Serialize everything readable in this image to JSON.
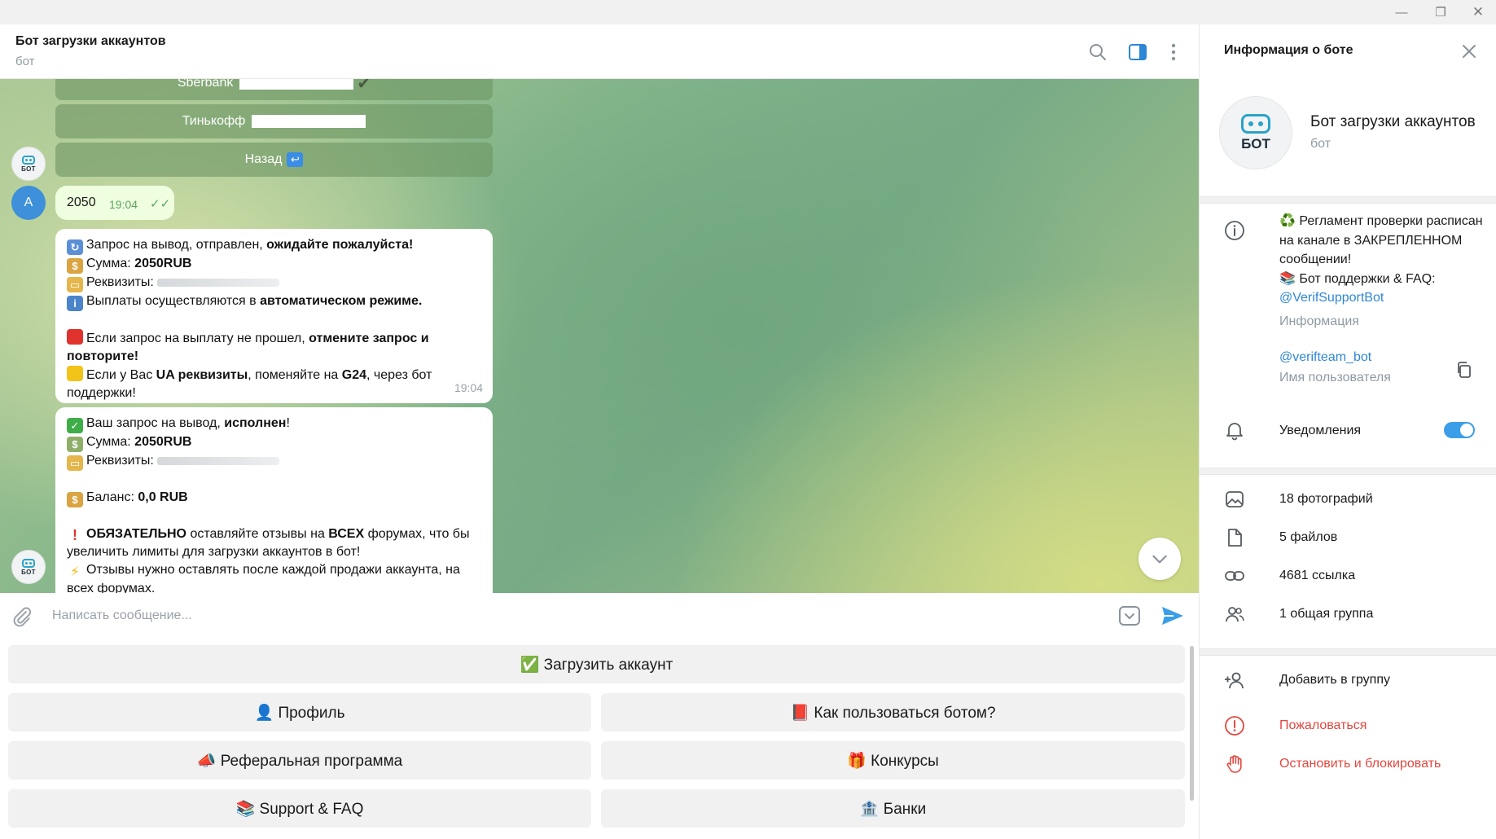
{
  "window": {
    "minimize": "—",
    "maximize": "❐",
    "close": "✕"
  },
  "chat": {
    "title": "Бот загрузки аккаунтов",
    "status": "бот"
  },
  "messages": {
    "inline_buttons": [
      "Sberbank",
      "Тинькофф",
      "Назад"
    ],
    "bot_avatar_label": "БОТ",
    "user_avatar_letter": "A",
    "outgoing": {
      "text": "2050",
      "time": "19:04"
    },
    "withdraw_request": {
      "line1_a": "Запрос на вывод,  отправлен, ",
      "line1_b": "ожидайте пожалуйста!",
      "line2_a": "Сумма: ",
      "line2_b": "2050RUB",
      "line3_a": "Реквизиты: ",
      "line4_a": "Выплаты осуществляются в ",
      "line4_b": "автоматическом режиме.",
      "line5_a": "Если запрос на выплату не прошел, ",
      "line5_b": "отмените запрос и повторите!",
      "line6_a": "Если у Вас ",
      "line6_b": "UA реквизиты",
      "line6_c": ", поменяйте на ",
      "line6_d": "G24",
      "line6_e": ", через бот поддержки!",
      "time": "19:04"
    },
    "withdraw_done": {
      "line1_a": "Ваш запрос на вывод, ",
      "line1_b": "исполнен",
      "line1_c": "!",
      "line2_a": "Сумма: ",
      "line2_b": "2050RUB",
      "line3_a": "Реквизиты: ",
      "line4_a": "Баланс: ",
      "line4_b": "0,0 RUB",
      "line5_a": "ОБЯЗАТЕЛЬНО",
      "line5_b": " оставляйте отзывы на ",
      "line5_c": "ВСЕХ",
      "line5_d": " форумах, что бы увеличить лимиты для загрузки аккаунтов в бот!",
      "line6_a": "Отзывы нужно оставлять после каждой продажи аккаунта, на всех форумах."
    }
  },
  "input": {
    "placeholder": "Написать сообщение..."
  },
  "keyboard": {
    "upload": "✅ Загрузить аккаунт",
    "profile": "👤 Профиль",
    "how_to": "📕 Как пользоваться ботом?",
    "referral": "📣 Реферальная программа",
    "contests": "🎁 Конкурсы",
    "support": "📚 Support & FAQ",
    "banks": "🏦 Банки"
  },
  "panel": {
    "title": "Информация о боте",
    "name": "Бот загрузки аккаунтов",
    "sub": "бот",
    "avatar_label": "БОТ",
    "info_line1": "♻️ Регламент проверки расписан на канале в ЗАКРЕПЛЕННОМ сообщении!",
    "info_line2": "📚 Бот поддержки & FAQ:",
    "info_link": "@VerifSupportBot",
    "info_caption": "Информация",
    "username": "@verifteam_bot",
    "username_caption": "Имя пользователя",
    "notifications": "Уведомления",
    "notifications_on": true,
    "photos": "18 фотографий",
    "files": "5 файлов",
    "links": "4681 ссылка",
    "groups": "1 общая группа",
    "add_to_group": "Добавить в группу",
    "report": "Пожаловаться",
    "block": "Остановить и блокировать"
  },
  "colors": {
    "accent": "#3a9ee8",
    "link": "#2e87d4",
    "danger": "#e2473f",
    "outgoing_bubble": "#eefedf"
  }
}
